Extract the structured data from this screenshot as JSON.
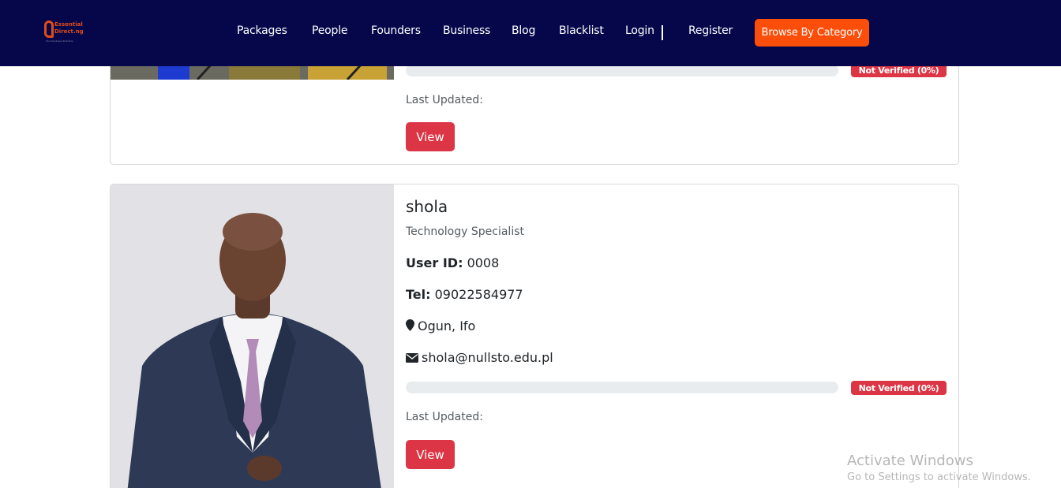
{
  "nav": {
    "logo_line1": "Essential",
    "logo_line2": "Direct.ng",
    "logo_tagline": "Your business directory",
    "links": [
      "Packages",
      "People",
      "Founders",
      "Business",
      "Blog",
      "Blacklist",
      "Login",
      "Register"
    ],
    "category_button": "Browse By Category"
  },
  "colors": {
    "navbar": "#05074a",
    "accent": "#fb4e0b",
    "danger": "#dc3545"
  },
  "cards": [
    {
      "verification_badge": "Not Verified (0%)",
      "verification_progress": 0,
      "last_updated_label": "Last Updated:",
      "view_button": "View"
    },
    {
      "name": "shola",
      "title": "Technology Specialist",
      "user_id_label": "User ID:",
      "user_id": "0008",
      "tel_label": "Tel:",
      "tel": "09022584977",
      "location_icon": "map-marker-icon",
      "location": "Ogun, Ifo",
      "email_icon": "envelope-icon",
      "email": "shola@nullsto.edu.pl",
      "verification_badge": "Not Verified (0%)",
      "verification_progress": 0,
      "last_updated_label": "Last Updated:",
      "view_button": "View"
    }
  ],
  "watermark": {
    "line1": "Activate Windows",
    "line2": "Go to Settings to activate Windows."
  }
}
